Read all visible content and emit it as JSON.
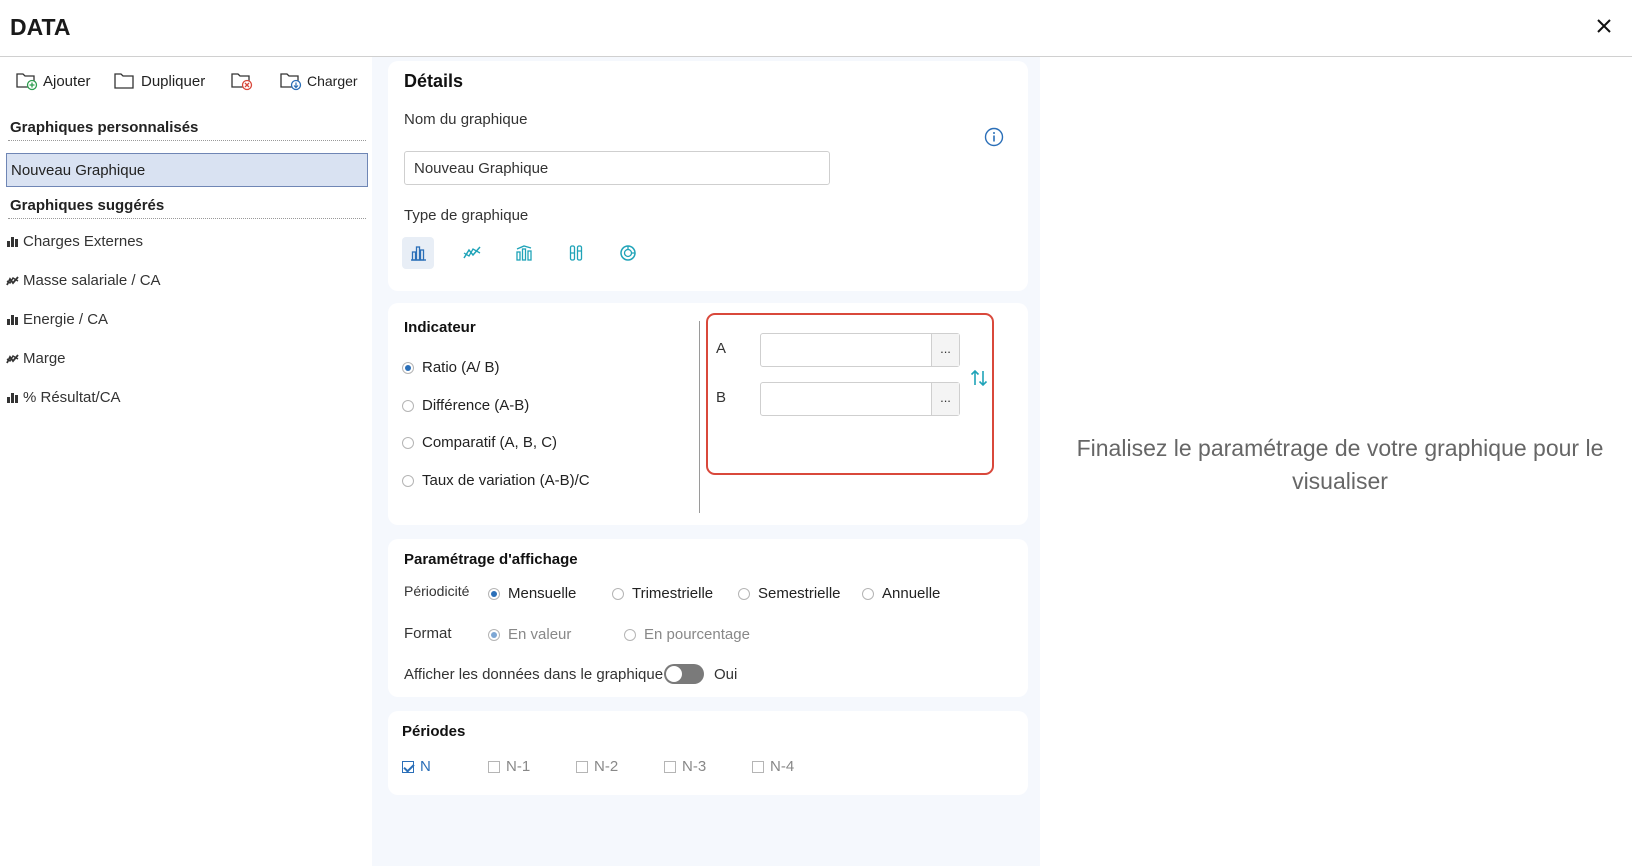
{
  "header": {
    "title": "DATA"
  },
  "toolbar": {
    "add": "Ajouter",
    "duplicate": "Dupliquer",
    "load": "Charger"
  },
  "custom": {
    "title": "Graphiques personnalisés",
    "items": [
      "Nouveau Graphique"
    ]
  },
  "suggested": {
    "title": "Graphiques suggérés",
    "items": [
      {
        "label": "Charges Externes",
        "icon": "bar-chart-icon"
      },
      {
        "label": "Masse salariale / CA",
        "icon": "line-chart-icon"
      },
      {
        "label": "Energie / CA",
        "icon": "bar-chart-icon"
      },
      {
        "label": "Marge",
        "icon": "line-chart-icon"
      },
      {
        "label": "% Résultat/CA",
        "icon": "bar-chart-icon"
      }
    ]
  },
  "details": {
    "title": "Détails",
    "name_label": "Nom du graphique",
    "name_value": "Nouveau Graphique",
    "type_label": "Type de graphique"
  },
  "indicator": {
    "title": "Indicateur",
    "options": [
      "Ratio (A/ B)",
      "Différence (A-B)",
      "Comparatif (A, B, C)",
      "Taux de variation (A-B)/C"
    ],
    "selected": 0,
    "a_label": "A",
    "b_label": "B",
    "dots": "..."
  },
  "display": {
    "title": "Paramétrage d'affichage",
    "periodicity_label": "Périodicité",
    "periodicity": [
      "Mensuelle",
      "Trimestrielle",
      "Semestrielle",
      "Annuelle"
    ],
    "format_label": "Format",
    "format": [
      "En valeur",
      "En pourcentage"
    ],
    "show_data_label": "Afficher les données dans le graphique",
    "show_data_value": "Oui"
  },
  "periods": {
    "title": "Périodes",
    "items": [
      "N",
      "N-1",
      "N-2",
      "N-3",
      "N-4"
    ],
    "checked": [
      true,
      false,
      false,
      false,
      false
    ]
  },
  "preview": {
    "message_line1": "Finalisez le paramétrage de votre graphique pour le",
    "message_line2": "visualiser"
  },
  "colors": {
    "accent": "#2b6fb8",
    "highlight": "#d9483b",
    "selected_bg": "#d9e2f2",
    "middle_bg": "#f5f8fd"
  }
}
